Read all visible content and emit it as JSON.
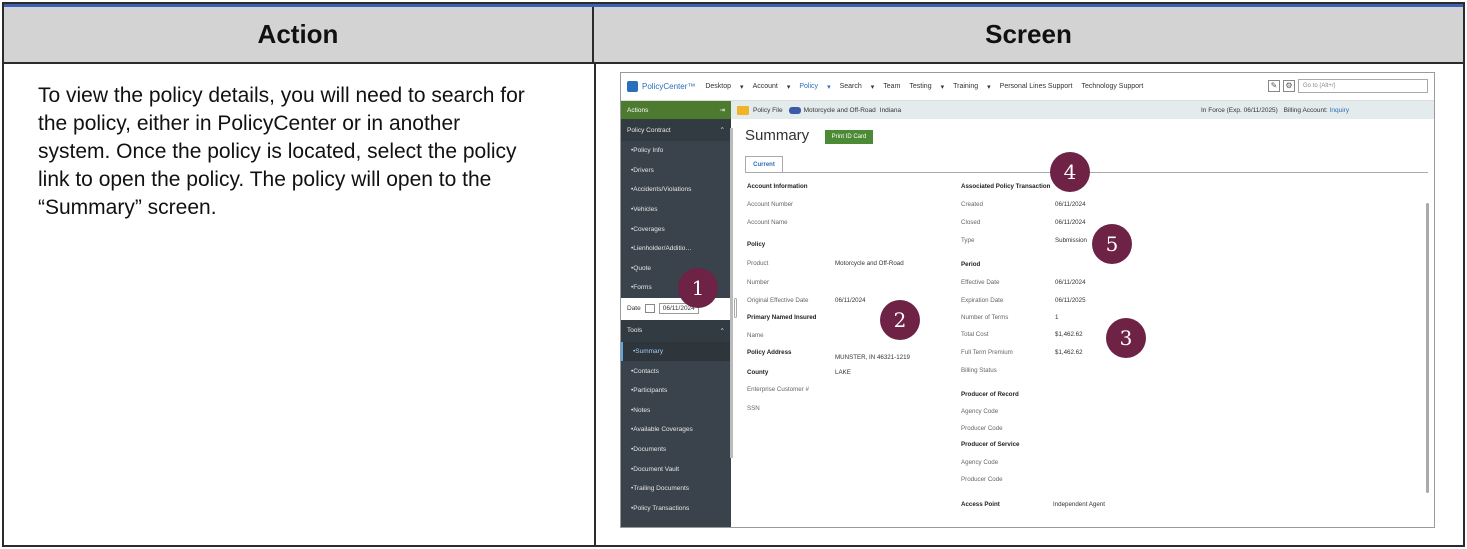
{
  "headers": {
    "action": "Action",
    "screen": "Screen"
  },
  "action_text": "To view the policy details, you will need to search for the policy, either in PolicyCenter or in another system. Once the policy is located, select the policy link to open the policy. The policy will open to the “Summary” screen.",
  "topnav": {
    "logo": "PolicyCenter™",
    "items": [
      "Desktop",
      "▾",
      "Account",
      "▾",
      "Policy",
      "▾",
      "Search",
      "▾",
      "Team",
      "Testing",
      "▾",
      "Training",
      "▾",
      "Personal Lines Support",
      "Technology Support"
    ],
    "goto_placeholder": "Go to (Alt+/)"
  },
  "infobar": {
    "policy_file": "Policy File",
    "product": "Motorcycle and Off-Road",
    "state": "Indiana",
    "status": "In Force (Exp. 06/11/2025)",
    "billing_label": "Billing Account:",
    "billing_link": "Inquiry"
  },
  "sidebar": {
    "actions": "Actions",
    "section_contract": "Policy Contract",
    "contract_items": [
      "Policy Info",
      "Drivers",
      "Accidents/Violations",
      "Vehicles",
      "Coverages",
      "Lienholder/Additio…",
      "Quote",
      "Forms"
    ],
    "date_label": "Date",
    "date_value": "06/11/2024",
    "section_tools": "Tools",
    "tools_items": [
      "Summary",
      "Contacts",
      "Participants",
      "Notes",
      "Available Coverages",
      "Documents",
      "Document Vault",
      "Trailing Documents",
      "Policy Transactions"
    ]
  },
  "main": {
    "title": "Summary",
    "print_button": "Print ID Card",
    "tab": "Current",
    "left": {
      "account_info": "Account Information",
      "account_number": "Account Number",
      "account_name": "Account Name",
      "policy": "Policy",
      "product": "Product",
      "product_value": "Motorcycle and Off-Road",
      "number": "Number",
      "orig_eff_date": "Original Effective Date",
      "orig_eff_date_value": "06/11/2024",
      "primary_insured": "Primary Named Insured",
      "name": "Name",
      "policy_address": "Policy Address",
      "policy_address_value": "MUNSTER, IN 46321-1219",
      "county": "County",
      "county_value": "LAKE",
      "enterprise_customer": "Enterprise Customer #",
      "ssn": "SSN"
    },
    "right": {
      "assoc_tx": "Associated Policy Transaction",
      "created": "Created",
      "created_value": "06/11/2024",
      "closed": "Closed",
      "closed_value": "06/11/2024",
      "type": "Type",
      "type_value": "Submission",
      "period": "Period",
      "effective_date": "Effective Date",
      "effective_date_value": "06/11/2024",
      "expiration_date": "Expiration Date",
      "expiration_date_value": "06/11/2025",
      "num_terms": "Number of Terms",
      "num_terms_value": "1",
      "total_cost": "Total Cost",
      "total_cost_value": "$1,462.62",
      "full_term_premium": "Full Term Premium",
      "full_term_premium_value": "$1,462.62",
      "billing_status": "Billing Status",
      "producer_record": "Producer of Record",
      "agency_code": "Agency Code",
      "producer_code": "Producer Code",
      "producer_service": "Producer of Service",
      "agency_code_2": "Agency Code",
      "producer_code_2": "Producer Code",
      "access_point": "Access Point",
      "access_point_value": "Independent Agent"
    }
  },
  "callouts": [
    "1",
    "2",
    "3",
    "4",
    "5"
  ],
  "colors": {
    "callout": "#6e2246",
    "sidebar": "#3a434b",
    "accent": "#2a6fba",
    "button": "#4c8a35"
  }
}
